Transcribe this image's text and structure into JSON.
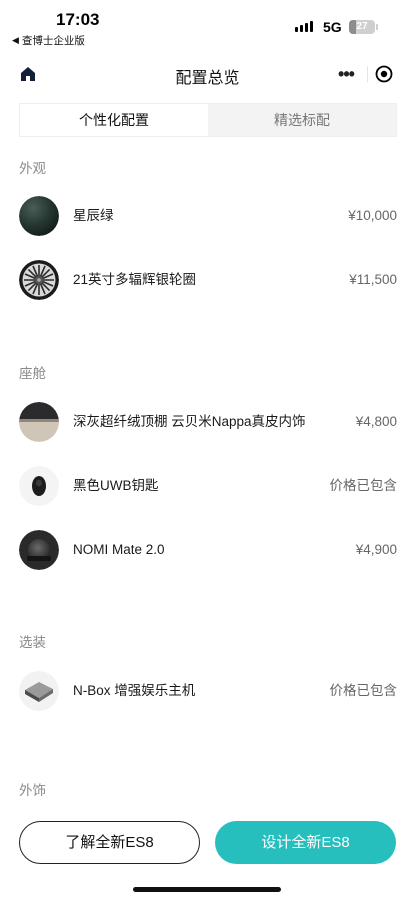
{
  "status_bar": {
    "time": "17:03",
    "back_app": "查博士企业版",
    "network": "5G",
    "battery": "27"
  },
  "header": {
    "title": "配置总览"
  },
  "tabs": [
    {
      "label": "个性化配置",
      "active": true
    },
    {
      "label": "精选标配",
      "active": false
    }
  ],
  "sections": {
    "exterior": {
      "title": "外观",
      "items": [
        {
          "name": "星辰绿",
          "price": "¥10,000",
          "icon": "green-paint-swatch"
        },
        {
          "name": "21英寸多辐辉银轮圈",
          "price": "¥11,500",
          "icon": "wheel-rim"
        }
      ]
    },
    "cabin": {
      "title": "座舱",
      "items": [
        {
          "name": "深灰超纤绒顶棚 云贝米Nappa真皮内饰",
          "price": "¥4,800",
          "icon": "interior-swatch"
        },
        {
          "name": "黑色UWB钥匙",
          "price": "价格已包含",
          "icon": "key-fob"
        },
        {
          "name": "NOMI Mate 2.0",
          "price": "¥4,900",
          "icon": "nomi-device"
        }
      ]
    },
    "options": {
      "title": "选装",
      "items": [
        {
          "name": "N-Box 增强娱乐主机",
          "price": "价格已包含",
          "icon": "nbox-console"
        }
      ]
    },
    "trim": {
      "title": "外饰"
    }
  },
  "footer": {
    "learn_label": "了解全新ES8",
    "design_label": "设计全新ES8"
  },
  "colors": {
    "accent": "#26bfbd",
    "paint": "#243530"
  }
}
